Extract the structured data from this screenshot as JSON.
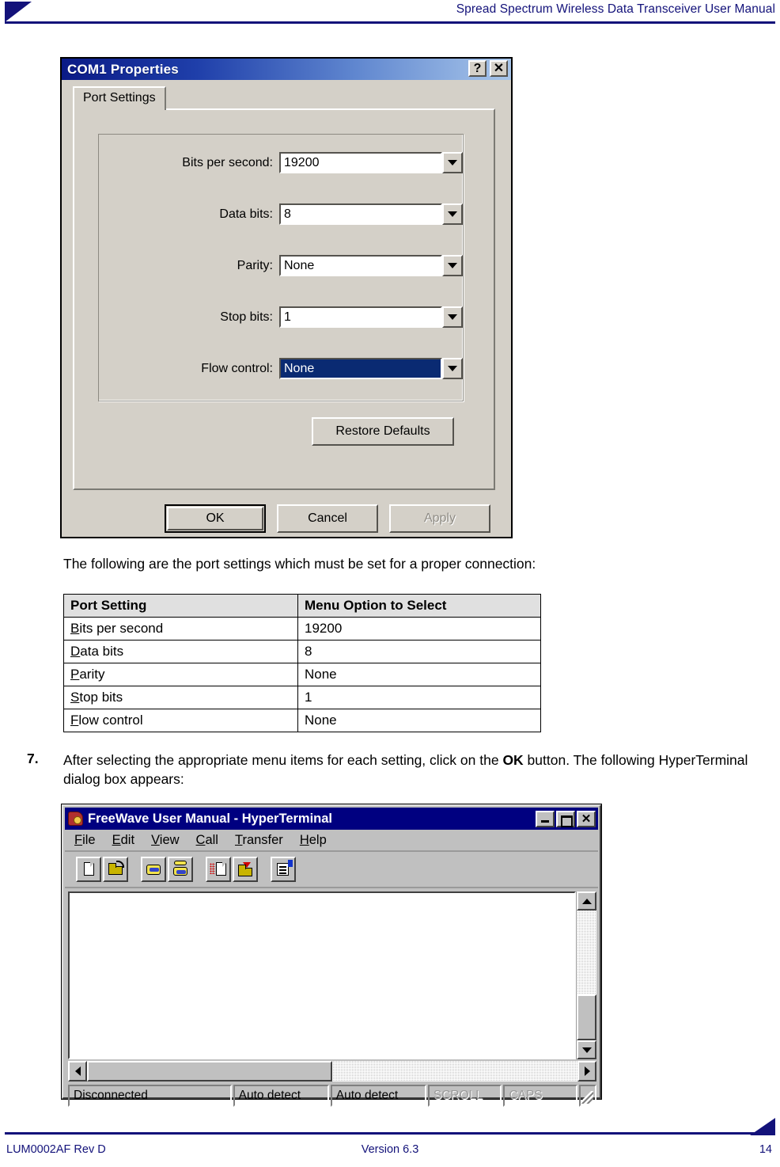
{
  "header": {
    "title": "Spread Spectrum Wireless Data Transceiver User Manual"
  },
  "footer": {
    "doc_id": "LUM0002AF Rev D",
    "version": "Version 6.3",
    "page_number": "14"
  },
  "com1_dialog": {
    "title": "COM1 Properties",
    "help_button": "?",
    "close_button": "✕",
    "tab": "Port Settings",
    "fields": [
      {
        "label": "Bits per second:",
        "value": "19200",
        "focused": false
      },
      {
        "label": "Data bits:",
        "value": "8",
        "focused": false
      },
      {
        "label": "Parity:",
        "value": "None",
        "focused": false
      },
      {
        "label": "Stop bits:",
        "value": "1",
        "focused": false
      },
      {
        "label": "Flow control:",
        "value": "None",
        "focused": true
      }
    ],
    "restore_defaults": "Restore Defaults",
    "ok": "OK",
    "cancel": "Cancel",
    "apply": "Apply"
  },
  "body": {
    "intro_paragraph": "The following are the port settings which must be set for a proper connection:",
    "step_number": "7.",
    "step_text_before": "After selecting the appropriate menu items for each setting, click on the ",
    "step_text_bold": "OK",
    "step_text_after": " button. The following HyperTerminal dialog box appears:"
  },
  "settings_table": {
    "headers": [
      "Port Setting",
      "Menu Option to Select"
    ],
    "rows": [
      {
        "accel": "B",
        "rest": "its per second",
        "option": "19200"
      },
      {
        "accel": "D",
        "rest": "ata bits",
        "option": "8"
      },
      {
        "accel": "P",
        "rest": "arity",
        "option": "None"
      },
      {
        "accel": "S",
        "rest": "top bits",
        "option": "1"
      },
      {
        "accel": "F",
        "rest": "low control",
        "option": "None"
      }
    ]
  },
  "hyperterminal": {
    "title": "FreeWave User Manual - HyperTerminal",
    "minimize": "_",
    "maximize": "□",
    "close": "✕",
    "menus": [
      {
        "accel": "F",
        "rest": "ile"
      },
      {
        "accel": "E",
        "rest": "dit"
      },
      {
        "accel": "V",
        "rest": "iew"
      },
      {
        "accel": "C",
        "rest": "all"
      },
      {
        "accel": "T",
        "rest": "ransfer"
      },
      {
        "accel": "H",
        "rest": "elp"
      }
    ],
    "toolbar_icons": [
      "new-connection-icon",
      "open-folder-icon",
      "dial-phone-icon",
      "disconnect-phone-icon",
      "send-file-icon",
      "receive-file-icon",
      "properties-icon"
    ],
    "status": {
      "connection": "Disconnected",
      "detect1": "Auto detect",
      "detect2": "Auto detect",
      "scroll": "SCROLL",
      "caps": "CAPS"
    }
  },
  "colors": {
    "brand_navy": "#13127a",
    "win_face": "#d4d0c8",
    "win95_face": "#c0c0c0",
    "title_navy": "#000080",
    "highlight": "#0a2a72",
    "table_header_bg": "#e0e0e0"
  }
}
